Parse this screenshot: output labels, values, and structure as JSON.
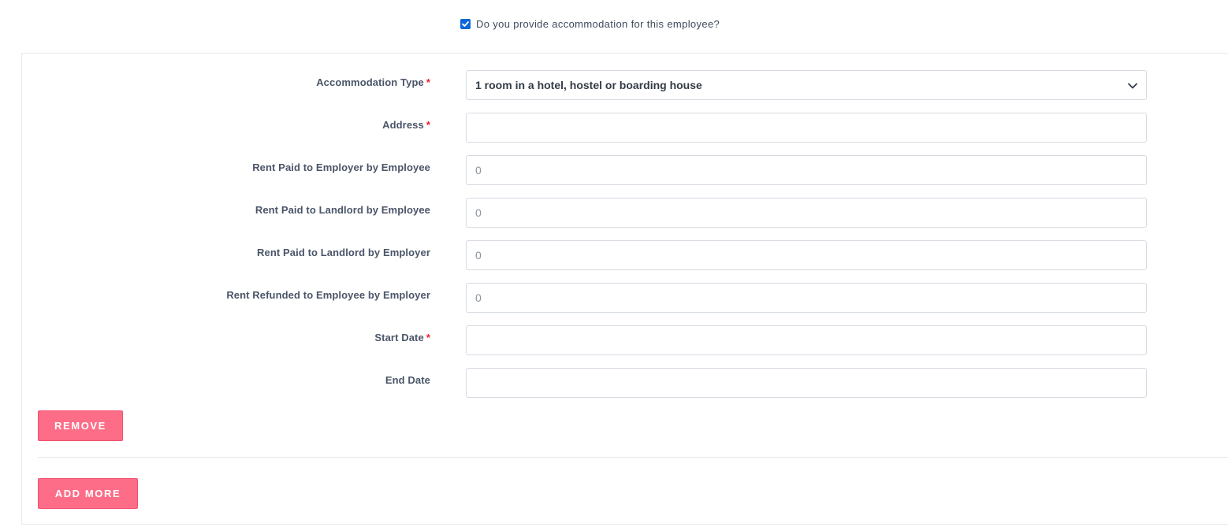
{
  "accommodation_checkbox": {
    "label": "Do you provide accommodation for this employee?",
    "checked": true
  },
  "form": {
    "accommodation_type": {
      "label": "Accommodation Type",
      "required": "*",
      "value": "1 room in a hotel, hostel or boarding house"
    },
    "address": {
      "label": "Address",
      "required": "*",
      "value": ""
    },
    "rent_employer_by_employee": {
      "label": "Rent Paid to Employer by Employee",
      "value": "0"
    },
    "rent_landlord_by_employee": {
      "label": "Rent Paid to Landlord by Employee",
      "value": "0"
    },
    "rent_landlord_by_employer": {
      "label": "Rent Paid to Landlord by Employer",
      "value": "0"
    },
    "rent_refunded_by_employer": {
      "label": "Rent Refunded to Employee by Employer",
      "value": "0"
    },
    "start_date": {
      "label": "Start Date",
      "required": "*",
      "value": ""
    },
    "end_date": {
      "label": "End Date",
      "value": ""
    }
  },
  "buttons": {
    "remove": "REMOVE",
    "add_more": "ADD MORE"
  },
  "colors": {
    "accent": "#fd6d87",
    "checkbox": "#0b66d8",
    "required": "#e8202a"
  }
}
